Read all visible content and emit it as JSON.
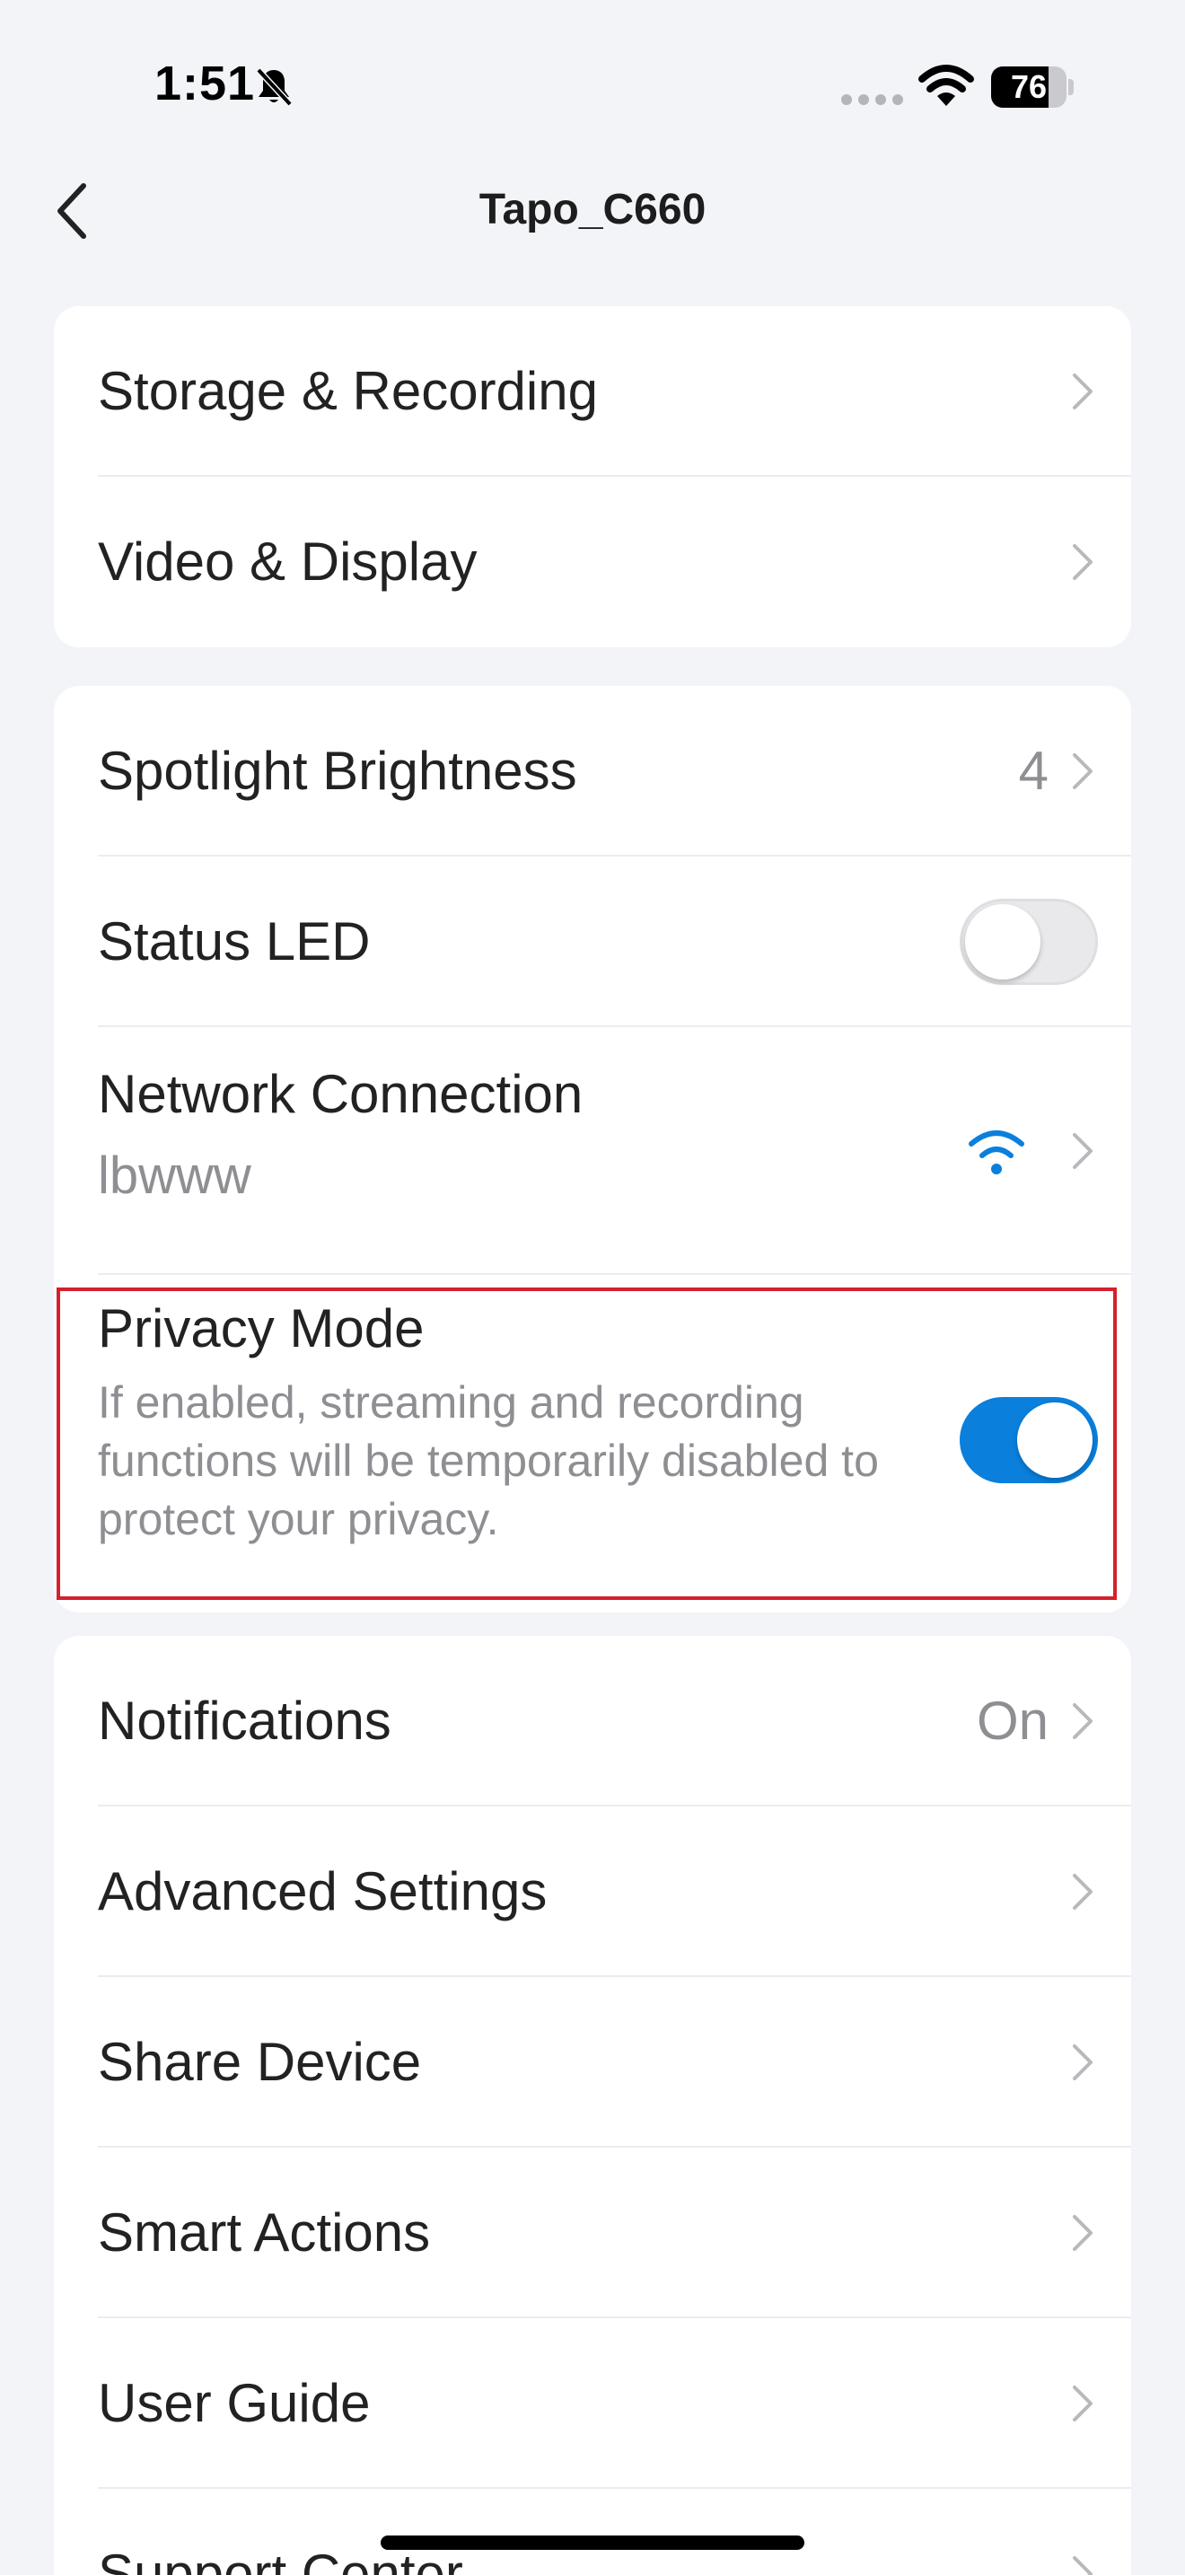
{
  "status_bar": {
    "time": "1:51",
    "battery_percent": "76",
    "battery_level": 0.76,
    "icons": [
      "bell-slash-icon",
      "signal-dots-icon",
      "wifi-icon",
      "battery-icon"
    ]
  },
  "nav": {
    "title": "Tapo_C660",
    "back_icon": "chevron-left-icon"
  },
  "colors": {
    "accent": "#0a7fdc",
    "background": "#f3f4f8",
    "highlight": "#d5202e",
    "secondary_text": "#8e8e93"
  },
  "sections": {
    "storage_recording": {
      "label": "Storage & Recording"
    },
    "video_display": {
      "label": "Video & Display"
    },
    "spotlight_brightness": {
      "label": "Spotlight Brightness",
      "value": "4"
    },
    "status_led": {
      "label": "Status LED",
      "enabled": false
    },
    "network_connection": {
      "label": "Network Connection",
      "network": "lbwww"
    },
    "privacy_mode": {
      "label": "Privacy Mode",
      "description": "If enabled, streaming and recording functions will be temporarily disabled to protect your privacy.",
      "enabled": true
    },
    "notifications": {
      "label": "Notifications",
      "value": "On"
    },
    "advanced_settings": {
      "label": "Advanced Settings"
    },
    "share_device": {
      "label": "Share Device"
    },
    "smart_actions": {
      "label": "Smart Actions"
    },
    "user_guide": {
      "label": "User Guide"
    },
    "support_center": {
      "label": "Support Center"
    }
  }
}
